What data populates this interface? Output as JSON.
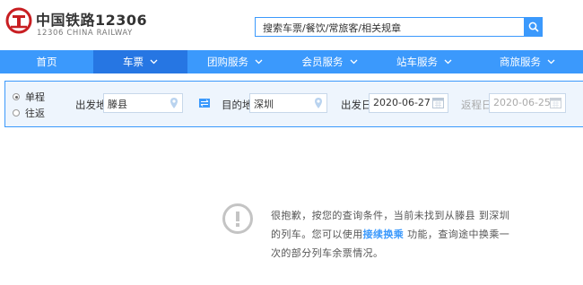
{
  "header": {
    "brand_cn": "中国铁路12306",
    "brand_en": "12306 CHINA RAILWAY",
    "search_placeholder": "搜索车票/餐饮/常旅客/相关规章",
    "logo_icon": "railway-logo-icon",
    "brand_color": "#c81e22"
  },
  "nav": {
    "items": [
      {
        "label": "首页",
        "dropdown": false,
        "active": false
      },
      {
        "label": "车票",
        "dropdown": true,
        "active": true
      },
      {
        "label": "团购服务",
        "dropdown": true,
        "active": false
      },
      {
        "label": "会员服务",
        "dropdown": true,
        "active": false
      },
      {
        "label": "站车服务",
        "dropdown": true,
        "active": false
      },
      {
        "label": "商旅服务",
        "dropdown": true,
        "active": false
      }
    ],
    "color": "#3b99fc",
    "active_color": "#2676e3"
  },
  "query": {
    "trip_types": [
      {
        "label": "单程",
        "checked": true
      },
      {
        "label": "往返",
        "checked": false
      }
    ],
    "from_label": "出发地",
    "from_value": "滕县",
    "to_label": "目的地",
    "to_value": "深圳",
    "depart_label": "出发日",
    "depart_value": "2020-06-27",
    "return_label": "返程日",
    "return_value": "2020-06-25"
  },
  "message": {
    "line1": "很抱歉，按您的查询条件，当前未找到从滕县 到深圳",
    "line2_prefix": "的列车。您可以使用",
    "link": "接续换乘",
    "line2_suffix": " 功能，查询途中换乘一",
    "line3": "次的部分列车余票情况。"
  }
}
